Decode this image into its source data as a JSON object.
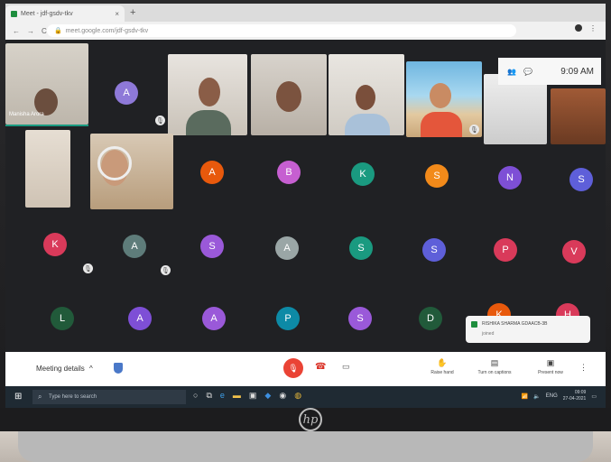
{
  "browser": {
    "tab_title": "Meet - jdf-gsdv-tkv",
    "tab_close": "×",
    "new_tab": "+",
    "back": "←",
    "forward": "→",
    "reload": "C",
    "url": "meet.google.com/jdf-gsdv-tkv",
    "menu": "⋮"
  },
  "clock": {
    "time": "9:09 AM"
  },
  "participants": {
    "top_video_name": "Manisha Arora",
    "avatars_row1": [
      "A",
      "B",
      "K",
      "S",
      "N",
      "S"
    ],
    "avatars_row2": [
      "K",
      "A",
      "S",
      "A",
      "S",
      "S",
      "P",
      "V"
    ],
    "avatars_row3": [
      "L",
      "A",
      "A",
      "P",
      "S",
      "D",
      "K",
      "H"
    ],
    "avatar_top": "A"
  },
  "toast": {
    "title": "RISHIKA SHARMA  GDAACB-3B",
    "subtitle": "joined"
  },
  "meet_bar": {
    "meeting_details": "Meeting details",
    "chevron": "^",
    "raise_hand": "Raise hand",
    "captions": "Turn on captions",
    "present": "Present now",
    "more": "⋮"
  },
  "taskbar": {
    "search_placeholder": "Type here to search",
    "tray_time": "09:09",
    "tray_date": "27-04-2021",
    "tray_lang": "ENG"
  },
  "brand": {
    "logo": "hp"
  },
  "colors": {
    "meet_bg": "#202124",
    "end_call": "#ea4335",
    "avatar_orange": "#e8590c",
    "avatar_pink": "#c65fd1",
    "avatar_teal": "#1a9a80",
    "avatar_amber": "#f28a1a",
    "avatar_purple": "#7e4fd6",
    "avatar_indigo": "#5e5fd9",
    "avatar_red": "#d93a5a",
    "avatar_gray": "#5e7c7a",
    "avatar_violet": "#9a59d9",
    "avatar_silver": "#9aa6a6",
    "avatar_cyan": "#0d8aa6",
    "avatar_green": "#215a3a"
  }
}
